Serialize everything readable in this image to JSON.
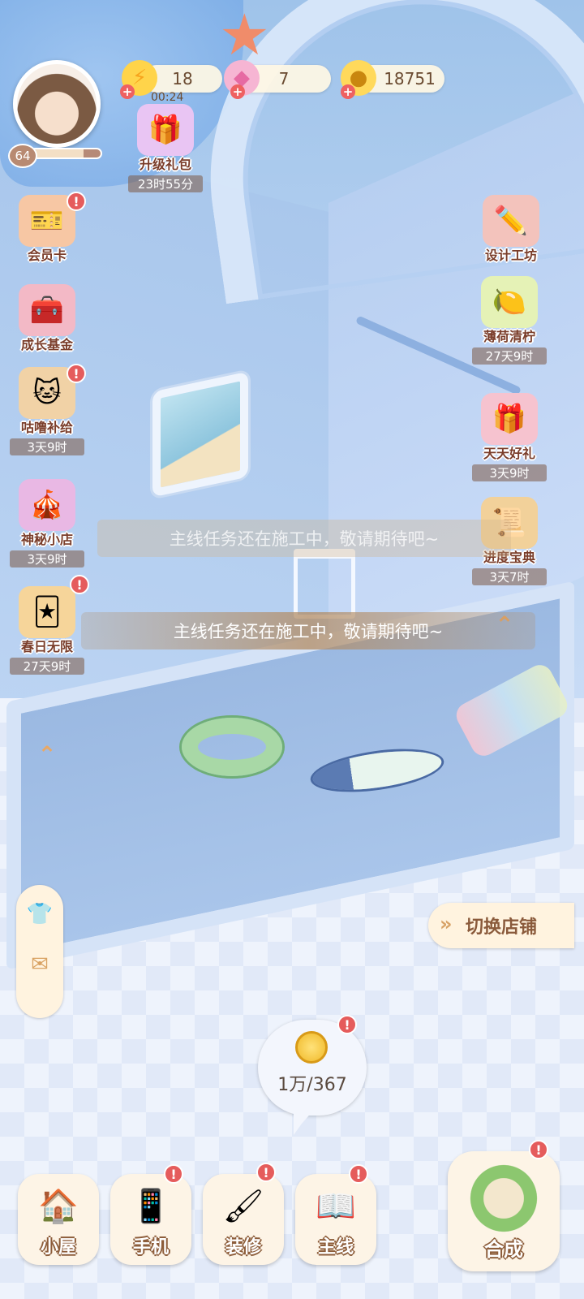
{
  "resources": {
    "energy": {
      "value": "18",
      "timer": "00:24",
      "icon": "lightning-icon"
    },
    "gems": {
      "value": "7",
      "icon": "gem-icon"
    },
    "coins": {
      "value": "18751",
      "icon": "coin-icon"
    }
  },
  "player": {
    "level": "64",
    "level_progress": 0.75
  },
  "left_icons": [
    {
      "label": "升级礼包",
      "timer": "23时55分"
    },
    {
      "label": "会员卡"
    },
    {
      "label": "成长基金"
    },
    {
      "label": "咕噜补给",
      "timer": "3天9时"
    },
    {
      "label": "神秘小店",
      "timer": "3天9时"
    },
    {
      "label": "春日无限",
      "timer": "27天9时"
    }
  ],
  "right_icons": [
    {
      "label": "设计工坊"
    },
    {
      "label": "薄荷清柠",
      "timer": "27天9时"
    },
    {
      "label": "天天好礼",
      "timer": "3天9时"
    },
    {
      "label": "进度宝典",
      "timer": "3天7时"
    }
  ],
  "toasts": {
    "faded": "主线任务还在施工中，敬请期待吧~",
    "main": "主线任务还在施工中，敬请期待吧~"
  },
  "switch_shop": "切换店铺",
  "coin_bubble": "1万/367",
  "badge": "!",
  "bottom_nav": [
    {
      "label": "小屋"
    },
    {
      "label": "手机"
    },
    {
      "label": "装修"
    },
    {
      "label": "主线"
    },
    {
      "label": "合成"
    }
  ],
  "colors": {
    "accent": "#e9a865",
    "badge": "#e55c5c",
    "label_brown": "#7a3d2a"
  }
}
